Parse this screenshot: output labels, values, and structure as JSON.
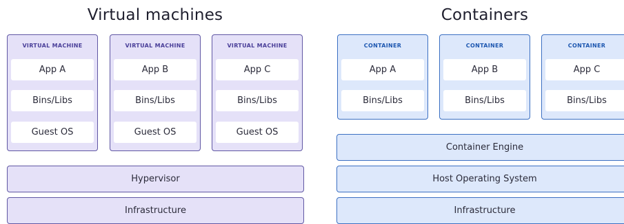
{
  "virtual_machines": {
    "title": "Virtual machines",
    "units": [
      {
        "label": "VIRTUAL MACHINE",
        "app": "App A",
        "bins": "Bins/Libs",
        "os": "Guest OS"
      },
      {
        "label": "VIRTUAL MACHINE",
        "app": "App B",
        "bins": "Bins/Libs",
        "os": "Guest OS"
      },
      {
        "label": "VIRTUAL MACHINE",
        "app": "App C",
        "bins": "Bins/Libs",
        "os": "Guest OS"
      }
    ],
    "layers": [
      "Hypervisor",
      "Infrastructure"
    ]
  },
  "containers": {
    "title": "Containers",
    "units": [
      {
        "label": "CONTAINER",
        "app": "App A",
        "bins": "Bins/Libs"
      },
      {
        "label": "CONTAINER",
        "app": "App B",
        "bins": "Bins/Libs"
      },
      {
        "label": "CONTAINER",
        "app": "App C",
        "bins": "Bins/Libs"
      }
    ],
    "layers": [
      "Container Engine",
      "Host Operating System",
      "Infrastructure"
    ]
  },
  "colors": {
    "vm_fill": "#e5e1f8",
    "vm_border": "#5f56a3",
    "container_fill": "#dde8fb",
    "container_border": "#3b6fc2"
  }
}
